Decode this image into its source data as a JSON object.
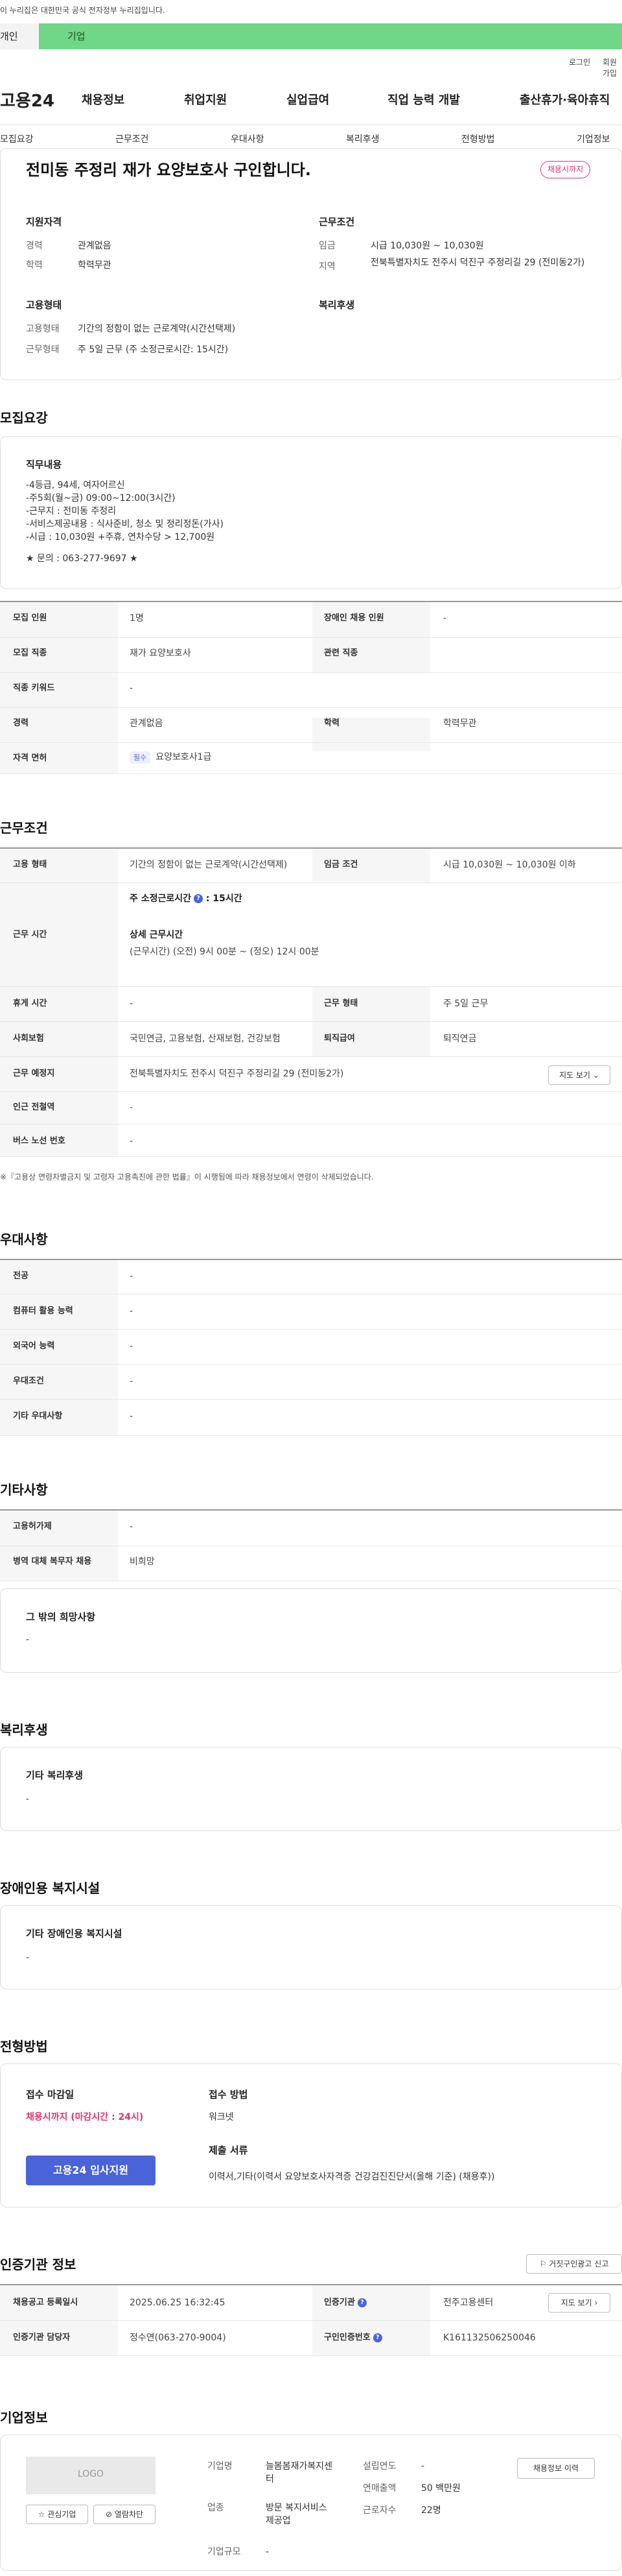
{
  "gov_banner": "이 누리집은 대한민국 공식 전자정부 누리집입니다.",
  "segment": {
    "left": "개인",
    "right": "기업"
  },
  "util": {
    "login": "로그인",
    "join": "회원가입"
  },
  "logo": "고용24",
  "gnb": [
    "채용정보",
    "취업지원",
    "실업급여",
    "직업 능력 개발",
    "출산휴가·육아휴직"
  ],
  "subnav": [
    "모집요강",
    "근무조건",
    "우대사항",
    "복리후생",
    "전형방법",
    "기업정보"
  ],
  "summary": {
    "title": "전미동 주정리 재가 요양보호사 구인합니다.",
    "status_pill": "채용시까지",
    "qual_title": "지원자격",
    "career_label": "경력",
    "career_value": "관계없음",
    "edu_label": "학력",
    "edu_value": "학력무관",
    "emp_title": "고용형태",
    "emptype_label": "고용형태",
    "emptype_value": "기간의 정함이 없는 근로계약(시간선택제)",
    "worktime_label": "근무형태",
    "worktime_value": "주 5일 근무 (주 소정근로시간: 15시간)",
    "cond_title": "근무조건",
    "wage_label": "임금",
    "wage_value": "시급 10,030원 ~ 10,030원",
    "region_label": "지역",
    "region_value": "전북특별자치도 전주시 덕진구 주정리길 29 (전미동2가)",
    "welfare_title": "복리후생"
  },
  "recruit": {
    "section_title": "모집요강",
    "duty_title": "직무내용",
    "duty_text": "-4등급, 94세, 여자어르신\n-주5회(월~금) 09:00~12:00(3시간)\n-근무지 : 전미동 주정리\n-서비스제공내용 : 식사준비, 청소 및 정리정돈(가사)\n-시급 : 10,030원 +주휴, 연차수당 > 12,700원",
    "contact": "★ 문의 : 063-277-9697 ★",
    "rows": {
      "count_label": "모집 인원",
      "count_value": "1명",
      "disabled_label": "장애인 채용 인원",
      "disabled_value": "-",
      "job_label": "모집 직종",
      "job_value": "재가 요양보호사",
      "related_label": "관련 직종",
      "related_value": "",
      "keyword_label": "직종 키워드",
      "keyword_value": "-",
      "career_label": "경력",
      "career_value": "관계없음",
      "edu_label": "학력",
      "edu_value": "학력무관",
      "license_label": "자격 면허",
      "license_tag": "필수",
      "license_value": "요양보호사1급"
    }
  },
  "conditions": {
    "section_title": "근무조건",
    "emptype_label": "고용 형태",
    "emptype_value": "기간의 정함이 없는 근로계약(시간선택제)",
    "wage_label": "임금 조건",
    "wage_value": "시급 10,030원 ~ 10,030원 이하",
    "worktime_label": "근무 시간",
    "worktime_week": "주 소정근로시간",
    "worktime_week_value": ": 15시간",
    "worktime_detail_title": "상세 근무시간",
    "worktime_detail": "(근무시간) (오전) 9시 00분 ~ (정오) 12시 00분",
    "rest_label": "휴게 시간",
    "rest_value": "-",
    "form_label": "근무 형태",
    "form_value": "주 5일 근무",
    "insurance_label": "사회보험",
    "insurance_value": "국민연금, 고용보험, 산재보험, 건강보험",
    "severance_label": "퇴직급여",
    "severance_value": "퇴직연금",
    "place_label": "근무 예정지",
    "place_value": "전북특별자치도 전주시 덕진구 주정리길 29 (전미동2가)",
    "map_btn": "지도 보기",
    "subway_label": "인근 전철역",
    "subway_value": "-",
    "bus_label": "버스 노선 번호",
    "bus_value": "-",
    "note": "※『고용상 연령차별금지 및 고령자 고용촉진에 관한 법률』이 시행됨에 따라 채용정보에서 연령이 삭제되었습니다."
  },
  "preference": {
    "section_title": "우대사항",
    "major_label": "전공",
    "major_value": "-",
    "computer_label": "컴퓨터 활용 능력",
    "computer_value": "-",
    "language_label": "외국어 능력",
    "language_value": "-",
    "pref_label": "우대조건",
    "pref_value": "-",
    "other_label": "기타 우대사항",
    "other_value": "-"
  },
  "etc": {
    "section_title": "기타사항",
    "support_label": "고용허가제",
    "support_value": "-",
    "military_label": "병역 대체 복무자 채용",
    "military_value": "비희망",
    "wish_title": "그 밖의 희망사항",
    "wish_value": "-"
  },
  "welfare": {
    "section_title": "복리후생",
    "box_title": "기타 복리후생",
    "box_value": "-"
  },
  "disabled": {
    "section_title": "장애인용 복지시설",
    "box_title": "기타 장애인용 복지시설",
    "box_value": "-"
  },
  "selection": {
    "section_title": "전형방법",
    "deadline_title": "접수 마감일",
    "deadline_value": "채용시까지 (마감시간 : 24시)",
    "apply_btn": "고용24 입사지원",
    "method_title": "접수 방법",
    "method_value": "워크넷",
    "docs_title": "제출 서류",
    "docs_value": "이력서,기타(이력서 요양보호사자격증 건강검진진단서(올해 기준) (채용후))"
  },
  "agency": {
    "section_title": "인증기관 정보",
    "report_btn": "거짓구인광고 신고",
    "reg_label": "채용공고 등록일시",
    "reg_value": "2025.06.25 16:32:45",
    "org_label": "인증기관",
    "org_value": "전주고용센터",
    "map_btn": "지도 보기",
    "manager_label": "인증기관 담당자",
    "manager_value": "정수연(063-270-9004)",
    "num_label": "구인인증번호",
    "num_value": "K161132506250046"
  },
  "company": {
    "section_title": "기업정보",
    "logo_text": "LOGO",
    "fav_btn": "관심기업",
    "block_btn": "열람차단",
    "name_label": "기업명",
    "name_value": "늘봄봄재가복지센터",
    "industry_label": "업종",
    "industry_value": "방문 복지서비스 제공업",
    "size_label": "기업규모",
    "size_value": "-",
    "founded_label": "설립연도",
    "founded_value": "-",
    "revenue_label": "연매출액",
    "revenue_value": "50 백만원",
    "employees_label": "근로자수",
    "employees_value": "22명",
    "history_btn": "채용정보 이력"
  }
}
